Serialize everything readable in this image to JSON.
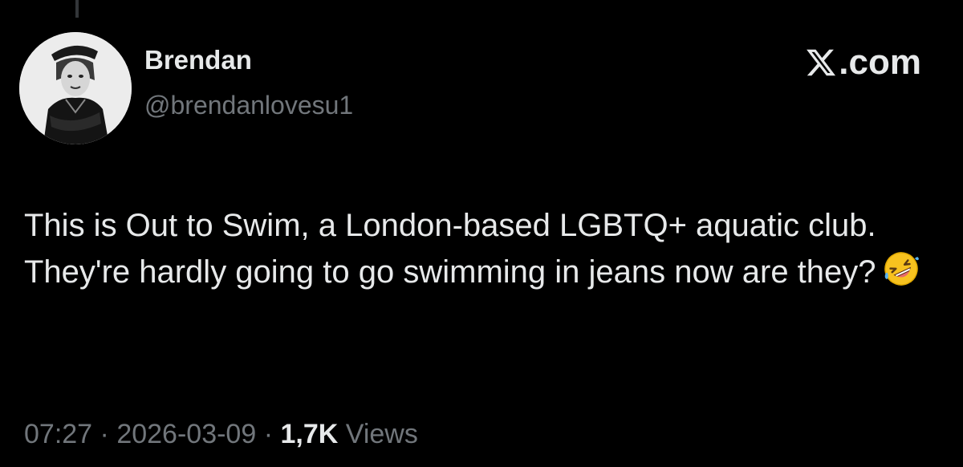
{
  "author": {
    "name": "Brendan",
    "handle": "@brendanlovesu1"
  },
  "brand": {
    "label": ".com",
    "icon": "x-logo-icon"
  },
  "tweet": {
    "text": "This is Out to Swim, a London-based LGBTQ+ aquatic club. They're hardly going to go swimming in jeans now are they?",
    "emoji": "rolling-on-floor-laughing-emoji"
  },
  "meta": {
    "time": "07:27",
    "separator": "·",
    "date": "2026-03-09",
    "views_count": "1,7K",
    "views_label": "Views"
  },
  "colors": {
    "background": "#000000",
    "text_primary": "#e7e9ea",
    "text_secondary": "#71767b"
  }
}
